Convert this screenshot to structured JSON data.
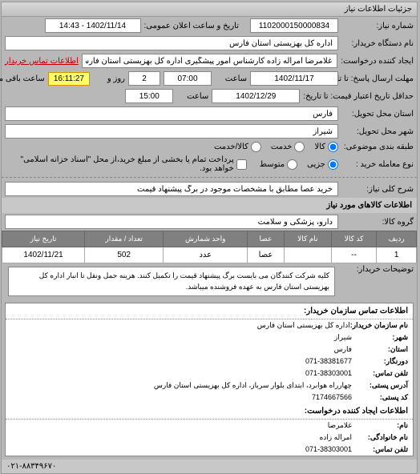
{
  "panel_title": "جزئیات اطلاعات نیاز",
  "fields": {
    "request_number_label": "شماره نیاز:",
    "request_number": "1102000150000834",
    "announce_label": "تاریخ و ساعت اعلان عمومی:",
    "announce_value": "1402/11/14 - 14:43",
    "device_name_label": "نام دستگاه خریدار:",
    "device_name": "اداره کل بهزیستی استان فارس",
    "requester_label": "ایجاد کننده درخواست:",
    "requester": "غلامرضا امراله زاده کارشناس امور پیشگیری اداره کل بهزیستی استان فارس",
    "contact_link": "اطلاعات تماس خریدار",
    "deadline_label": "مهلت ارسال پاسخ: تا تاریخ:",
    "deadline_date": "1402/11/17",
    "deadline_time_label": "ساعت",
    "deadline_time": "07:00",
    "days_label": "روز و",
    "days": "2",
    "remain_label": "ساعت باقی مانده",
    "countdown": "16:11:27",
    "validity_label": "حداقل تاریخ اعتبار قیمت: تا تاریخ:",
    "validity_date": "1402/12/29",
    "validity_time": "15:00",
    "delivery_state_label": "استان محل تحویل:",
    "delivery_state": "فارس",
    "delivery_city_label": "شهر محل تحویل:",
    "delivery_city": "شیراز",
    "category_label": "طبقه بندی موضوعی:",
    "cat_goods": "کالا",
    "cat_service": "خدمت",
    "cat_both": "کالا/خدمت",
    "purchase_type_label": "نوع معامله خرید :",
    "type_small": "جزیی",
    "type_medium": "متوسط",
    "payment_note": "پرداخت تمام یا بخشی از مبلغ خرید،از محل \"اسناد خزانه اسلامی\" خواهد بود.",
    "general_desc_label": "شرح کلی نیاز:",
    "general_desc": "خرید عصا مطابق با مشخصات موجود در برگ پیشنهاد قیمت",
    "goods_info_title": "اطلاعات کالاهای مورد نیاز",
    "goods_group_label": "گروه کالا:",
    "goods_group": "دارو، پزشکی و سلامت"
  },
  "table": {
    "headers": [
      "ردیف",
      "کد کالا",
      "نام کالا",
      "عصا",
      "واحد شمارش",
      "تعداد / مقدار",
      "تاریخ نیاز"
    ],
    "row": [
      "1",
      "--",
      "",
      "عصا",
      "عدد",
      "502",
      "1402/11/21"
    ]
  },
  "buyer_desc_label": "توضیحات خریدار:",
  "buyer_desc": "کلیه شرکت کنندگان می بایست برگ پیشنهاد قیمت را تکمیل کنند. هزینه حمل ونقل تا انبار اداره کل بهزیستی استان فارس به عهده فروشنده میباشد.",
  "contact": {
    "title": "اطلاعات تماس سازمان خریدار:",
    "org_label": "نام سازمان خریدار:",
    "org": "اداره کل بهزیستی استان فارس",
    "city_label": "شهر:",
    "city": "شیراز",
    "state_label": "استان:",
    "state": "فارس",
    "fax_label": "دورنگار:",
    "fax": "071-38381677",
    "phone_label": "تلفن تماس:",
    "phone": "071-38303001",
    "address_label": "آدرس پستی:",
    "address": "چهارراه هوابرد، ابتدای بلوار سرباز، اداره کل بهزیستی استان فارس",
    "postal_label": "کد پستی:",
    "postal": "7174667566",
    "creator_title": "اطلاعات ایجاد کننده درخواست:",
    "name_label": "نام:",
    "name": "غلامرضا",
    "lastname_label": "نام خانوادگی:",
    "lastname": "امراله زاده",
    "creator_phone_label": "تلفن تماس:",
    "creator_phone": "071-38303001"
  },
  "footer_phone": "۰۲۱-۸۸۳۴۹۶۷۰"
}
